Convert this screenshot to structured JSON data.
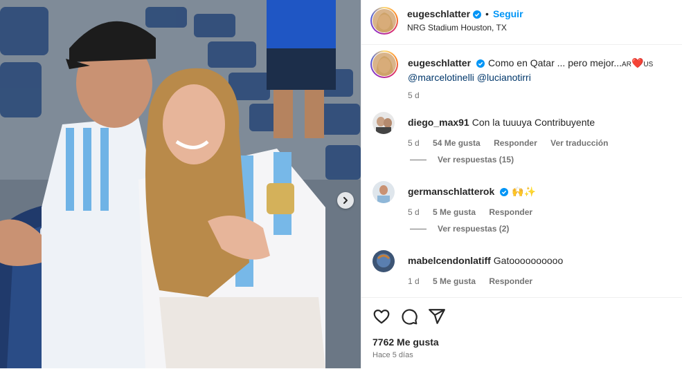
{
  "post": {
    "username": "eugeschlatter",
    "follow_label": "Seguir",
    "separator": "•",
    "location": "NRG Stadium Houston, TX"
  },
  "caption": {
    "username": "eugeschlatter",
    "text": "Como en Qatar ... pero mejor...",
    "suffix_left": "AR",
    "heart": "❤️",
    "suffix_right": "US",
    "mentions": [
      "@marcelotinelli",
      "@lucianotirri"
    ],
    "time": "5 d"
  },
  "comments": [
    {
      "username": "diego_max91",
      "text": "Con la tuuuya Contribuyente",
      "time": "5 d",
      "likes": "54 Me gusta",
      "reply_label": "Responder",
      "translate_label": "Ver traducción",
      "view_replies": "Ver respuestas (15)"
    },
    {
      "username": "germanschlatterok",
      "text": "🙌✨",
      "time": "5 d",
      "likes": "5 Me gusta",
      "reply_label": "Responder",
      "view_replies": "Ver respuestas (2)"
    },
    {
      "username": "mabelcendonlatiff",
      "text": "Gatoooooooooo",
      "time": "1 d",
      "likes": "5 Me gusta",
      "reply_label": "Responder"
    }
  ],
  "actions": {
    "like_count": "7762 Me gusta",
    "posted_ago": "Hace 5 días"
  },
  "icons": {
    "verified": "verified-badge-icon",
    "like": "heart-icon",
    "comment": "comment-icon",
    "share": "share-icon",
    "next": "chevron-right-icon"
  },
  "colors": {
    "accent": "#0095f6",
    "verified": "#0095f6",
    "muted": "#737373",
    "text": "#262626"
  }
}
